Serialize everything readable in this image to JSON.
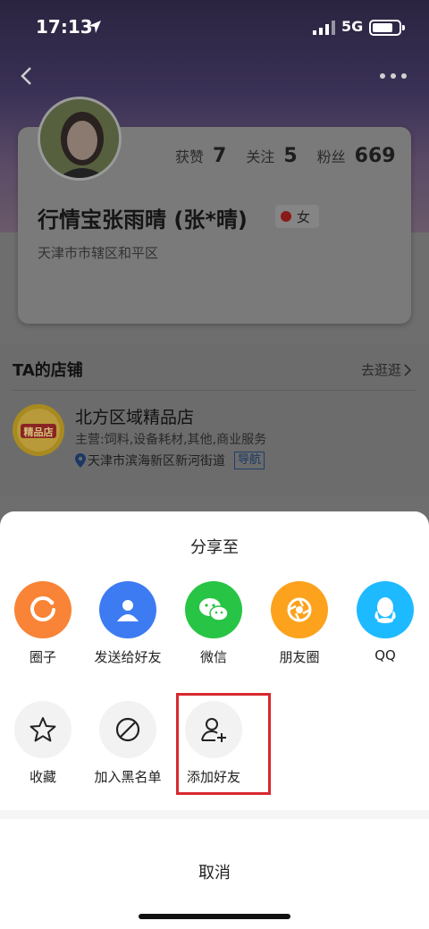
{
  "status_bar": {
    "time": "17:13",
    "network": "5G"
  },
  "profile": {
    "stats": [
      {
        "label": "获赞",
        "value": "7"
      },
      {
        "label": "关注",
        "value": "5"
      },
      {
        "label": "粉丝",
        "value": "669"
      }
    ],
    "name": "行情宝张雨晴 (张*晴)",
    "gender": "女",
    "location": "天津市市辖区和平区"
  },
  "shop": {
    "section_title": "TA的店铺",
    "visit_label": "去逛逛",
    "name": "北方区域精品店",
    "description": "主营:饲料,设备耗材,其他,商业服务",
    "address": "天津市滨海新区新河街道",
    "nav_label": "导航",
    "logo_text": "精品店"
  },
  "share_sheet": {
    "title": "分享至",
    "row1": [
      {
        "label": "圈子",
        "icon": "circle-icon",
        "color": "#f98336"
      },
      {
        "label": "发送给好友",
        "icon": "friend-icon",
        "color": "#3d7bf2"
      },
      {
        "label": "微信",
        "icon": "wechat-icon",
        "color": "#28c445"
      },
      {
        "label": "朋友圈",
        "icon": "moments-icon",
        "color": "#fca21d"
      },
      {
        "label": "QQ",
        "icon": "qq-icon",
        "color": "#1ebaff"
      }
    ],
    "row2": [
      {
        "label": "收藏",
        "icon": "star-icon"
      },
      {
        "label": "加入黑名单",
        "icon": "block-icon"
      },
      {
        "label": "添加好友",
        "icon": "add-friend-icon"
      }
    ],
    "cancel_label": "取消"
  }
}
